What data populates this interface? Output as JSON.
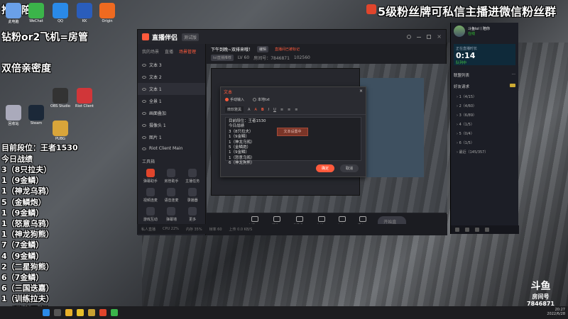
{
  "overlay": {
    "top_left": "推荐陪容",
    "top_right": "5级粉丝牌可私信主播进微信粉丝群",
    "line2": "钻粉or2飞机=房管",
    "line3": "双倍亲密度",
    "rank": "目前段位：王者1530",
    "today_title": "今日战绩",
    "records": [
      "3（8只拉夫）",
      "1（9金鳞）",
      "1（神龙乌鸦）",
      "5（金鳞炮）",
      "1（9金鳞）",
      "1（怒意乌鸦）",
      "1（神龙狗熊）",
      "7（7金鳞）",
      "4（9金鳞）",
      "2（二星狗熊）",
      "6（7金鳞）",
      "6（三国迭嘉）",
      "1（训练拉夫）",
      "6（秘术雪龙）"
    ]
  },
  "desktop_icons": [
    {
      "label": "此电脑",
      "color": "#6aa0e8"
    },
    {
      "label": "WeChat",
      "color": "#3bb44a"
    },
    {
      "label": "QQ",
      "color": "#2a8ae8"
    },
    {
      "label": "KK",
      "color": "#2a5dbb"
    },
    {
      "label": "Origin",
      "color": "#ef6a20"
    },
    {
      "label": "回收站",
      "color": "#aab"
    },
    {
      "label": "Steam",
      "color": "#1b2838"
    },
    {
      "label": "OBS Studio",
      "color": "#333"
    },
    {
      "label": "Riot Client",
      "color": "#d13639"
    },
    {
      "label": "PUBG",
      "color": "#d9a53a"
    }
  ],
  "app": {
    "logo": "直播伴侣",
    "version": "测试版",
    "tabs": [
      "我的场景",
      "直播",
      "场景管理"
    ],
    "active_tab": "场景管理",
    "scenes": [
      "文本 3",
      "文本 2",
      "文本 1",
      "全景 1",
      "画面叠加",
      "摄像头 1",
      "图片 1",
      "Riot Client Main"
    ],
    "selected_scene": "文本 1",
    "tools_title": "工具箱",
    "tools": [
      {
        "label": "弹幕助手",
        "red": true
      },
      {
        "label": "房管助手",
        "red": false
      },
      {
        "label": "主播任务",
        "red": false
      },
      {
        "label": "视频连麦",
        "red": false
      },
      {
        "label": "语音连麦",
        "red": false
      },
      {
        "label": "录播器",
        "red": false
      },
      {
        "label": "游戏互动",
        "red": false
      },
      {
        "label": "弹幕墙",
        "red": false
      },
      {
        "label": "更多",
        "red": false
      }
    ],
    "info": {
      "title": "下午到晚~双排来哦！",
      "edit": "编辑",
      "warning": "直播间已被标记",
      "category": "lol直播推荐",
      "level": "LV 60",
      "room": "房间号：7846871",
      "hot": "102560"
    },
    "bottom": [
      "直播画面",
      "摄像头",
      "手机投屏",
      "多媒体",
      "麦克风",
      "扬声器"
    ],
    "start_btn": "开始直播",
    "status": [
      "私人直播",
      "CPU 22%",
      "内存 35%",
      "帧率 60",
      "上传 0.0 KB/S"
    ]
  },
  "dialog": {
    "title": "文本",
    "close": "×",
    "radio": [
      "手动输入",
      "本地txt"
    ],
    "font": "微软雅黑",
    "editor_lines": [
      "目前段位：王者1530",
      "今日战绩",
      "3（8只拉夫）",
      "1（9金鳞）",
      "1（神龙乌鸦）",
      "5（金鳞炮）",
      "1（9金鳞）",
      "1（怒意乌鸦）",
      "6（神龙狗熊）"
    ],
    "overlay_box": "文本设置中",
    "ok": "确定",
    "cancel": "取消"
  },
  "right_panel": {
    "user": "斗鱼lol丨陪你",
    "status": "在线",
    "live_label": "正在直播时长",
    "live_time": "0:14",
    "live_sub": "队列中",
    "section1": "联盟列表",
    "section2": "好友请求",
    "groups": [
      "1（4/15）",
      "2（4/60）",
      "3（6/89）",
      "4（1/5）",
      "5（0/4）",
      "6（1/5）",
      "最近（145/357）"
    ]
  },
  "watermark": {
    "brand": "斗鱼",
    "room": "房间号",
    "number": "7846871"
  },
  "tray": {
    "time": "20:27",
    "date": "2022/6/28"
  }
}
